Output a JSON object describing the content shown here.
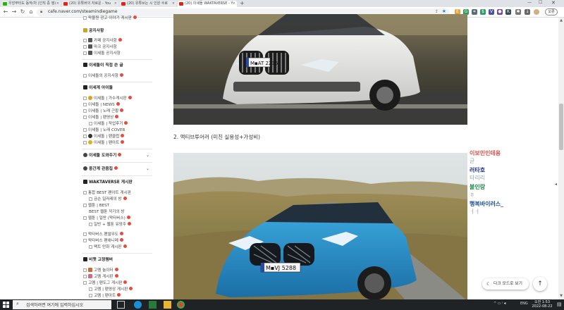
{
  "browser": {
    "tabs": [
      {
        "label": "우앙푸터도 동작/차 (인직 중 앵)"
      },
      {
        "label": "(20) 유튜버의 자로운 - You"
      },
      {
        "label": "(20) 유튜브는 시 인원 수로"
      },
      {
        "label": "(20) 이세돌 WAKTAVERSE - Y"
      }
    ],
    "url": "cafe.naver.com/steamindiegame",
    "profile_label": "오류"
  },
  "sidebar": {
    "items": [
      {
        "label": "왁물원 광고 이야기 게시판",
        "kind": "item",
        "new": true
      },
      {
        "label": "공지사항",
        "kind": "head"
      },
      {
        "label": "카페 공지사항",
        "kind": "item",
        "new": true
      },
      {
        "label": "마크 공지사항",
        "kind": "item",
        "new": false
      },
      {
        "label": "이세돌 공지사항",
        "kind": "item",
        "new": false
      },
      {
        "label": "이세돌이 직접 쓴 글",
        "kind": "head"
      },
      {
        "label": "이세돌의 공지사항",
        "kind": "item",
        "new": true
      },
      {
        "label": "이세계 아이돌",
        "kind": "head"
      },
      {
        "label": "이세돌 | 가수게시판",
        "kind": "item",
        "new": true
      },
      {
        "label": "이세돌 | NEWS",
        "kind": "item",
        "new": true
      },
      {
        "label": "이세돌 | 노래 근황",
        "kind": "item",
        "new": true
      },
      {
        "label": "이세돌 | 팬영상",
        "kind": "item",
        "new": true
      },
      {
        "label": "이세돌 | 작업후기",
        "kind": "item",
        "new": true
      },
      {
        "label": "이세돌 | 노래 COVER",
        "kind": "item",
        "new": false
      },
      {
        "label": "이세돌 | 팬클럽",
        "kind": "item",
        "new": true
      },
      {
        "label": "이세돌 | 팬아트",
        "kind": "item",
        "new": true
      },
      {
        "label": "이세돌 도와주기",
        "kind": "fold"
      },
      {
        "label": "중간계 관음집",
        "kind": "fold"
      },
      {
        "label": "WAKTAVERSE 게시판",
        "kind": "head"
      },
      {
        "label": "통합 BEST 팬아트 게시판",
        "kind": "item",
        "new": false
      },
      {
        "label": "금손 일러레의 방",
        "kind": "item",
        "new": true
      },
      {
        "label": "웹툰 | BEST",
        "kind": "item",
        "new": false
      },
      {
        "label": "BEST 웹툰 작가의 방",
        "kind": "item",
        "new": false
      },
      {
        "label": "웹툰 | 일반 (왁타버스)",
        "kind": "item",
        "new": true
      },
      {
        "label": "일반 + 웹툰 유망주",
        "kind": "item",
        "new": true
      },
      {
        "label": "왁타버스 팬썰무도",
        "kind": "item",
        "new": true
      },
      {
        "label": "왁타버스 팬애니메",
        "kind": "item",
        "new": true
      },
      {
        "label": "팩트 만화 게시판",
        "kind": "item",
        "new": true
      },
      {
        "label": "비챗 고정멤버",
        "kind": "head"
      },
      {
        "label": "고멤 놀이터",
        "kind": "item",
        "new": true
      },
      {
        "label": "고멤 게시판",
        "kind": "item",
        "new": true
      },
      {
        "label": "고멤 | 팬도그 게시판",
        "kind": "item",
        "new": true
      },
      {
        "label": "고멤 | 팬영상 게시판",
        "kind": "item",
        "new": true
      },
      {
        "label": "고멤 | 팬아트",
        "kind": "item",
        "new": true
      }
    ]
  },
  "content": {
    "image1": {
      "plate": "M▪AT 2235"
    },
    "caption": "2. 액티브투어러 (미친 실용성+가성비)",
    "image2": {
      "plate": "M▪VJ 5288"
    }
  },
  "chat": [
    {
      "name": "이보민인데용",
      "msg": "굳",
      "color": "#d9534f"
    },
    {
      "name": "러타호",
      "msg": "타리리",
      "color": "#1e2e8f"
    },
    {
      "name": "불인랑",
      "msg": "ㅎ",
      "color": "#1e8a4a"
    },
    {
      "name": "행복바이러스_",
      "msg": "ㅓㅓ",
      "color": "#1e4fa0"
    }
  ],
  "buttons": {
    "dark_mode": "다크 모드로 보기",
    "top": "↑"
  },
  "taskbar": {
    "search_placeholder": "검색하려면 여기에 입력하십시오",
    "tray": "ENG",
    "time": "오전 1:53",
    "date": "2022-08-22"
  },
  "icons": {
    "back": "back-arrow-icon",
    "forward": "forward-arrow-icon",
    "reload": "reload-icon",
    "home": "home-icon",
    "lock": "lock-icon"
  }
}
